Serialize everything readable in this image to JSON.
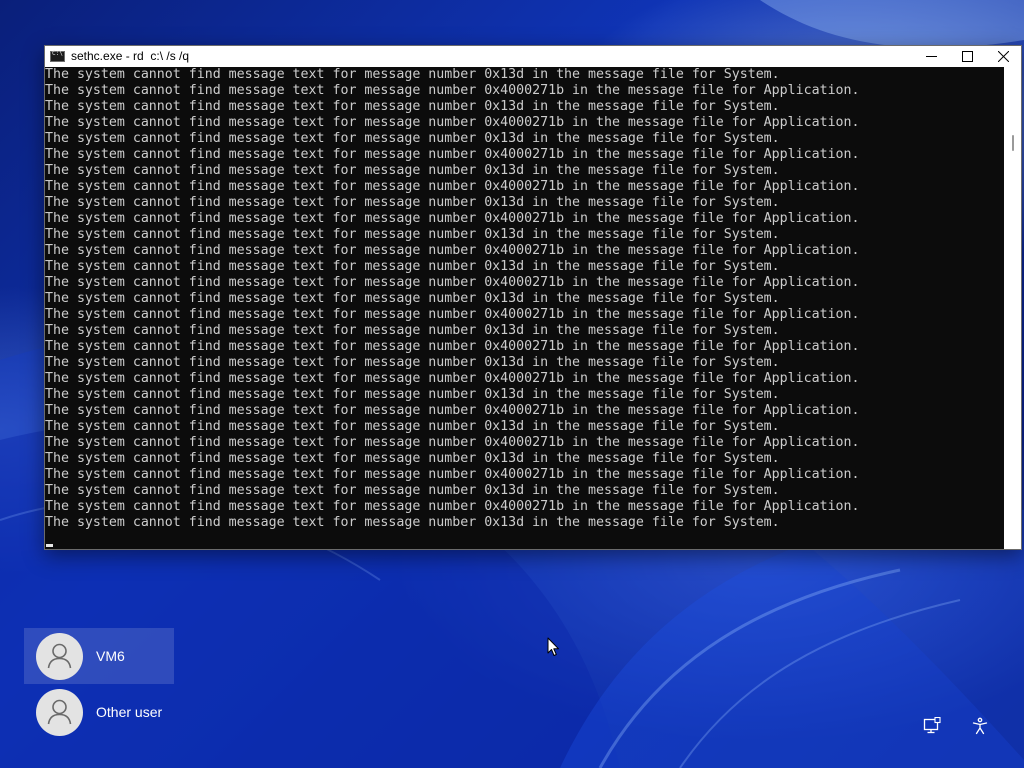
{
  "window": {
    "title": "sethc.exe - rd  c:\\ /s /q",
    "controls": [
      "minimize-icon",
      "maximize-icon",
      "close-icon"
    ]
  },
  "console": {
    "lines": [
      "The system cannot find message text for message number 0x13d in the message file for System.",
      "The system cannot find message text for message number 0x4000271b in the message file for Application.",
      "The system cannot find message text for message number 0x13d in the message file for System.",
      "The system cannot find message text for message number 0x4000271b in the message file for Application.",
      "The system cannot find message text for message number 0x13d in the message file for System.",
      "The system cannot find message text for message number 0x4000271b in the message file for Application.",
      "The system cannot find message text for message number 0x13d in the message file for System.",
      "The system cannot find message text for message number 0x4000271b in the message file for Application.",
      "The system cannot find message text for message number 0x13d in the message file for System.",
      "The system cannot find message text for message number 0x4000271b in the message file for Application.",
      "The system cannot find message text for message number 0x13d in the message file for System.",
      "The system cannot find message text for message number 0x4000271b in the message file for Application.",
      "The system cannot find message text for message number 0x13d in the message file for System.",
      "The system cannot find message text for message number 0x4000271b in the message file for Application.",
      "The system cannot find message text for message number 0x13d in the message file for System.",
      "The system cannot find message text for message number 0x4000271b in the message file for Application.",
      "The system cannot find message text for message number 0x13d in the message file for System.",
      "The system cannot find message text for message number 0x4000271b in the message file for Application.",
      "The system cannot find message text for message number 0x13d in the message file for System.",
      "The system cannot find message text for message number 0x4000271b in the message file for Application.",
      "The system cannot find message text for message number 0x13d in the message file for System.",
      "The system cannot find message text for message number 0x4000271b in the message file for Application.",
      "The system cannot find message text for message number 0x13d in the message file for System.",
      "The system cannot find message text for message number 0x4000271b in the message file for Application.",
      "The system cannot find message text for message number 0x13d in the message file for System.",
      "The system cannot find message text for message number 0x4000271b in the message file for Application.",
      "The system cannot find message text for message number 0x13d in the message file for System.",
      "The system cannot find message text for message number 0x4000271b in the message file for Application.",
      "The system cannot find message text for message number 0x13d in the message file for System."
    ],
    "colors": {
      "background": "#0c0c0c",
      "text": "#cccccc"
    }
  },
  "users": [
    {
      "name": "VM6",
      "selected": true,
      "icon": "user-avatar-icon"
    },
    {
      "name": "Other user",
      "selected": false,
      "icon": "user-avatar-icon"
    }
  ],
  "system_icons": [
    "network-icon",
    "accessibility-icon"
  ]
}
